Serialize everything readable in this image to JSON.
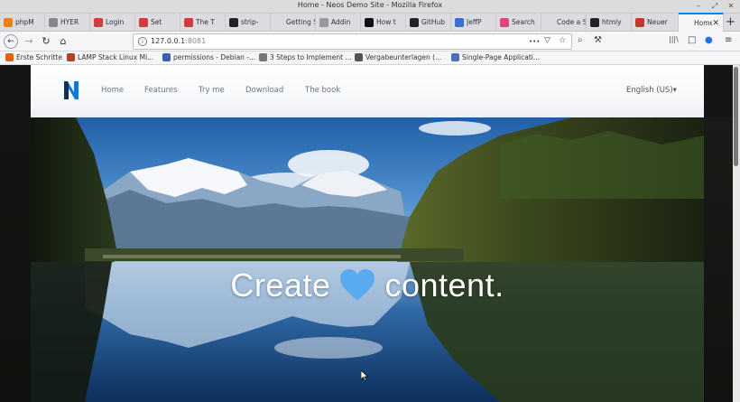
{
  "window": {
    "title": "Home - Neos Demo Site - Mozilla Firefox",
    "controls": [
      "–",
      "⤢",
      "✕"
    ]
  },
  "tabs": [
    {
      "label": "phpM",
      "icon": "phpmyadmin-icon",
      "color": "#e8821e"
    },
    {
      "label": "HYER",
      "icon": "page-icon",
      "color": "#888888"
    },
    {
      "label": "Login",
      "icon": "yii-icon",
      "color": "#d23c3c"
    },
    {
      "label": "Set",
      "icon": "yii-icon",
      "color": "#d23c3c"
    },
    {
      "label": "The T",
      "icon": "yii-icon",
      "color": "#d23c3c"
    },
    {
      "label": "strip-",
      "icon": "github-icon",
      "color": "#222222"
    },
    {
      "label": "Getting St",
      "icon": "none",
      "color": "#888888"
    },
    {
      "label": "Addin",
      "icon": "puzzle-icon",
      "color": "#999999"
    },
    {
      "label": "How t",
      "icon": "notion-icon",
      "color": "#111111"
    },
    {
      "label": "GitHub",
      "icon": "github-icon",
      "color": "#222222"
    },
    {
      "label": "JeffP",
      "icon": "jeff-icon",
      "color": "#3b6fd0"
    },
    {
      "label": "Search",
      "icon": "search-pink-icon",
      "color": "#e0457b"
    },
    {
      "label": "Code a Se",
      "icon": "none",
      "color": "#888888"
    },
    {
      "label": "htmly",
      "icon": "github-icon",
      "color": "#222222"
    },
    {
      "label": "Neuer",
      "icon": "vivaldi-icon",
      "color": "#c0392b"
    },
    {
      "label": "Home",
      "icon": "none",
      "color": "#888888",
      "active": true,
      "close": "✕"
    }
  ],
  "newtab": "+",
  "nav": {
    "back": "←",
    "forward": "→",
    "reload": "↻",
    "home": "⌂",
    "info": "i",
    "url_host": "127.0.0.1",
    "url_port": ":8081",
    "url_icons": [
      "•••",
      "▽",
      "☆"
    ],
    "right_tools": [
      "⌕",
      "⚒",
      "|||\\",
      "□",
      "●",
      "≡"
    ]
  },
  "bookmarks": [
    {
      "label": "Erste Schritte",
      "icon": "firefox-icon",
      "color": "#e66000"
    },
    {
      "label": "LAMP Stack Linux Mi...",
      "icon": "edit-icon",
      "color": "#c0392b"
    },
    {
      "label": "permissions - Debian -...",
      "icon": "debian-icon",
      "color": "#3a5fb0"
    },
    {
      "label": "3 Steps to Implement ...",
      "icon": "box-icon",
      "color": "#777777"
    },
    {
      "label": "Vergabeunterlagen (...",
      "icon": "globe-icon",
      "color": "#555555"
    },
    {
      "label": "Single-Page Applicati...",
      "icon": "stack-icon",
      "color": "#4a6fb5"
    }
  ],
  "site": {
    "logo": "N",
    "logo_color": "#1a73e8",
    "menu": [
      "Home",
      "Features",
      "Try me",
      "Download",
      "The book"
    ],
    "language": "English (US)▾",
    "hero_before": "Create",
    "hero_after": "content.",
    "heart_color": "#5aaaf0"
  }
}
